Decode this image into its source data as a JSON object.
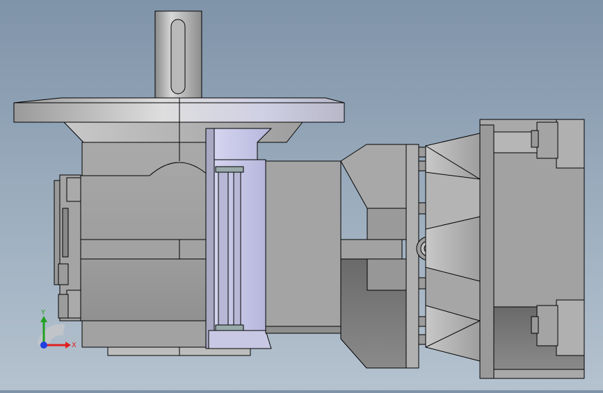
{
  "viewport": {
    "background_top": "#7f93a9",
    "background_bottom": "#b5c2cf",
    "model_color": "#9b9b9b",
    "edge_color": "#000000"
  },
  "triad": {
    "x_label": "X",
    "y_label": "Y",
    "x_color": "#e02020",
    "y_color": "#20a020",
    "z_color": "#2040e0"
  }
}
